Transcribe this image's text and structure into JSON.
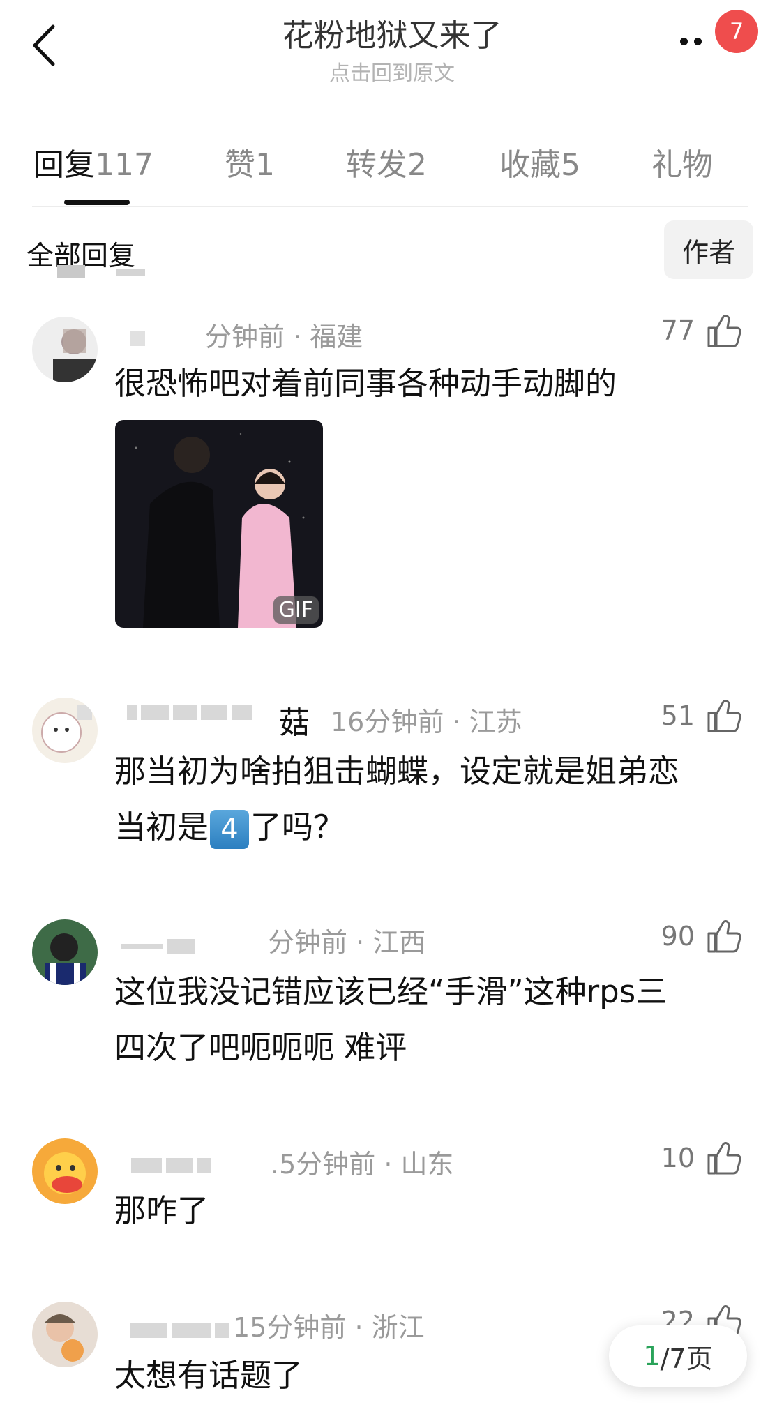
{
  "header": {
    "title": "花粉地狱又来了",
    "subtitle": "点击回到原文",
    "badge_count": "7"
  },
  "tabs": [
    {
      "label": "回复",
      "count": "117"
    },
    {
      "label": "赞",
      "count": "1"
    },
    {
      "label": "转发",
      "count": "2"
    },
    {
      "label": "收藏",
      "count": "5"
    },
    {
      "label": "礼物",
      "count": ""
    }
  ],
  "filter": {
    "all_replies": "全部回复",
    "author_button": "作者"
  },
  "comments": [
    {
      "name_suffix": "",
      "time": "分钟前",
      "location": "福建",
      "likes": "77",
      "text": "很恐怖吧对着前同事各种动手动脚的",
      "gif_label": "GIF"
    },
    {
      "name_suffix": "菇",
      "time": "16分钟前",
      "location": "江苏",
      "likes": "51",
      "text_line1": "那当初为啥拍狙击蝴蝶，设定就是姐弟恋",
      "text_line2_pre": "当初是",
      "keycap": "4",
      "text_line2_post": "了吗？"
    },
    {
      "name_suffix": "",
      "time": "分钟前",
      "location": "江西",
      "likes": "90",
      "text_line1": "这位我没记错应该已经“手滑”这种rps三",
      "text_line2": "四次了吧呃呃呃 难评"
    },
    {
      "name_suffix": "",
      "time": ".5分钟前",
      "location": "山东",
      "likes": "10",
      "text": "那咋了"
    },
    {
      "name_suffix": "",
      "time": "15分钟前",
      "location": "浙江",
      "likes": "22",
      "text": "太想有话题了"
    }
  ],
  "pager": {
    "current": "1",
    "total_text": "/7页"
  },
  "colors": {
    "badge": "#ef4d4d",
    "pager_current": "#2aa35a",
    "meta": "#9a9a9a"
  }
}
